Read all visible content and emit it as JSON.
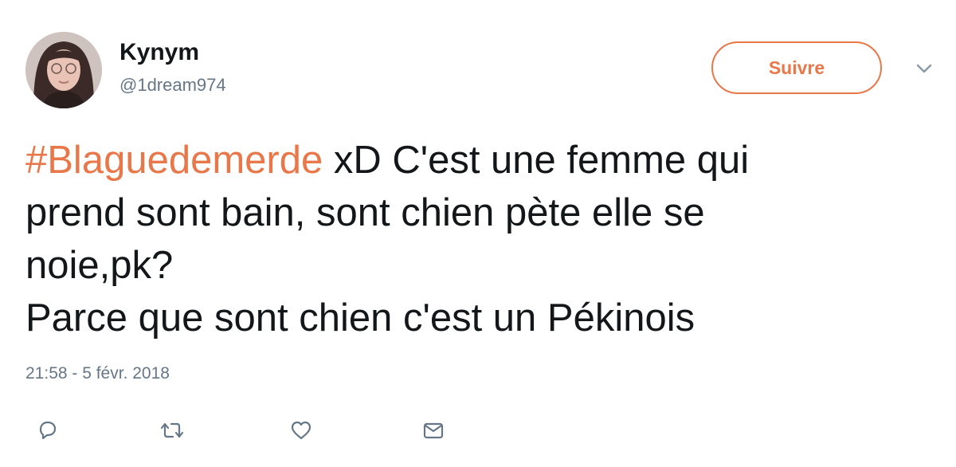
{
  "user": {
    "name": "Kynym",
    "handle": "@1dream974"
  },
  "follow_button": {
    "label": "Suivre"
  },
  "tweet": {
    "hashtag": "#Blaguedemerde",
    "line1_rest": " xD C'est une femme qui",
    "line2": "prend sont bain, sont chien pète elle se",
    "line3": "noie,pk?",
    "line4": "Parce que sont chien c'est un Pékinois"
  },
  "timestamp": "21:58 - 5 févr. 2018",
  "actions": [
    "reply-icon",
    "retweet-icon",
    "like-icon",
    "direct-message-icon"
  ],
  "colors": {
    "accent": "#e8774a",
    "text": "#14171a",
    "secondary": "#657786",
    "icon": "#657786"
  }
}
